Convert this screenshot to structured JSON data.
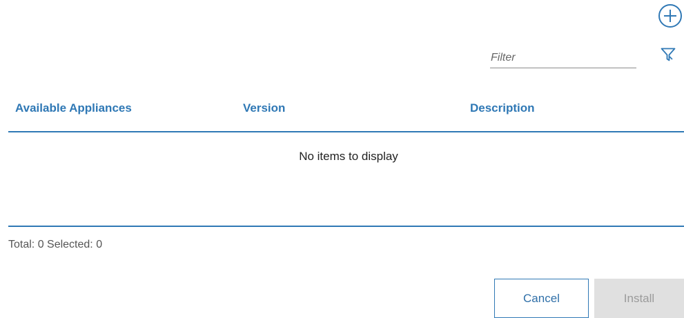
{
  "toolbar": {
    "add_icon": "plus-circle-icon",
    "filter_icon": "funnel-icon"
  },
  "filter": {
    "placeholder": "Filter",
    "value": ""
  },
  "table": {
    "columns": [
      "Available Appliances",
      "Version",
      "Description"
    ],
    "rows": [],
    "empty_message": "No items to display",
    "summary": "Total: 0 Selected: 0",
    "total": 0,
    "selected": 0
  },
  "actions": {
    "cancel_label": "Cancel",
    "install_label": "Install",
    "install_enabled": false
  },
  "colors": {
    "accent": "#2f78b5",
    "disabled_bg": "#e0e0e0",
    "disabled_text": "#9b9b9b"
  }
}
